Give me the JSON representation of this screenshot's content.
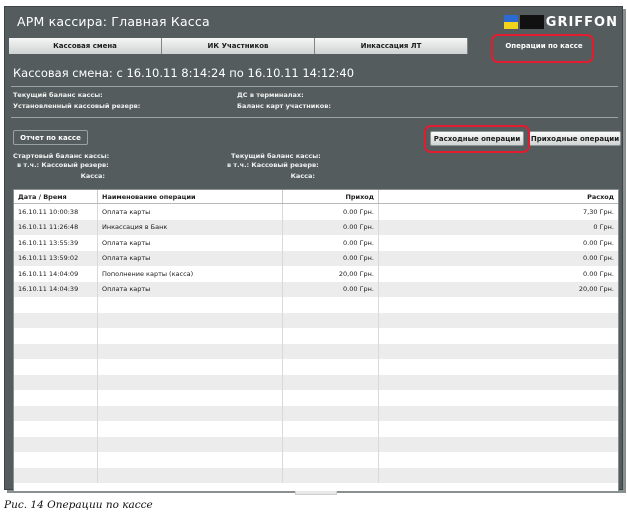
{
  "window": {
    "title": "АРМ кассира: Главная Касса",
    "logo_text": "GRIFFON"
  },
  "tabs": [
    {
      "label": "Кассовая смена",
      "active": false
    },
    {
      "label": "ИК Участников",
      "active": false
    },
    {
      "label": "Инкассация ЛТ",
      "active": false
    },
    {
      "label": "Операции по кассе",
      "active": true
    }
  ],
  "shift": {
    "heading": "Кассовая смена: с 16.10.11 8:14:24 по 16.10.11 14:12:40"
  },
  "summary": {
    "current_balance": "Текущий баланс кассы:",
    "reserve": "Установленный кассовый резерв:",
    "terminals": "ДС в терминалах:",
    "participants_balance": "Баланс карт участников:"
  },
  "buttons": {
    "report": "Отчет по кассе",
    "expense": "Расходные операции",
    "income": "Приходные операции"
  },
  "balances": {
    "start_label": "Стартовый баланс кассы:",
    "start_reserve": "в т.ч.: Кассовый резерв:",
    "start_cash": "Касса:",
    "current_label": "Текущий баланс кассы:",
    "current_reserve": "в т.ч.: Кассовый резерв:",
    "current_cash": "Касса:"
  },
  "table": {
    "columns": [
      "Дата / Время",
      "Наименование операции",
      "Приход",
      "Расход"
    ],
    "rows": [
      [
        "16.10.11 10:00:38",
        "Оплата карты",
        "0.00 Грн.",
        "7,30 Грн."
      ],
      [
        "16.10.11 11:26:48",
        "Инкассация в Банк",
        "0.00 Грн.",
        "0 Грн."
      ],
      [
        "16.10.11 13:55:39",
        "Оплата карты",
        "0.00 Грн.",
        "0.00 Грн."
      ],
      [
        "16.10.11 13:59:02",
        "Оплата карты",
        "0.00 Грн.",
        "0.00 Грн."
      ],
      [
        "16.10.11 14:04:09",
        "Пополнение карты (касса)",
        "20,00 Грн.",
        "0.00 Грн."
      ],
      [
        "16.10.11 14:04:39",
        "Оплата карты",
        "0.00 Грн.",
        "20,00 Грн."
      ]
    ],
    "total_visible_rows": 18
  },
  "caption": "Рис. 14 Операции по кассе",
  "colors": {
    "frame": "#545c5d",
    "highlight": "#e21c2e"
  }
}
